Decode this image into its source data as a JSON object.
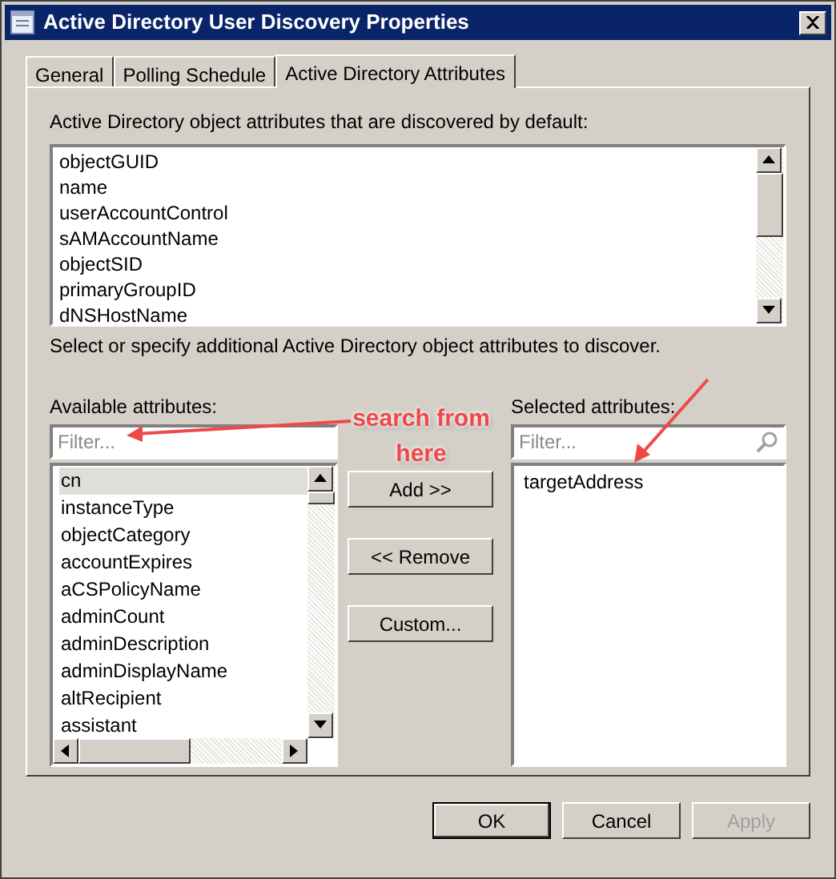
{
  "window": {
    "title": "Active Directory User Discovery Properties"
  },
  "tabs": [
    {
      "label": "General",
      "selected": false
    },
    {
      "label": "Polling Schedule",
      "selected": false
    },
    {
      "label": "Active Directory Attributes",
      "selected": true
    }
  ],
  "default_section": {
    "label": "Active Directory object attributes that are discovered by default:",
    "items": [
      "objectGUID",
      "name",
      "userAccountControl",
      "sAMAccountName",
      "objectSID",
      "primaryGroupID",
      "dNSHostName"
    ]
  },
  "hint": "Select or specify additional Active Directory object attributes to discover.",
  "available": {
    "label": "Available attributes:",
    "filter": {
      "placeholder": "Filter..."
    },
    "items": [
      {
        "text": "cn",
        "selected": true
      },
      {
        "text": "instanceType",
        "selected": false
      },
      {
        "text": "objectCategory",
        "selected": false
      },
      {
        "text": "accountExpires",
        "selected": false
      },
      {
        "text": "aCSPolicyName",
        "selected": false
      },
      {
        "text": "adminCount",
        "selected": false
      },
      {
        "text": "adminDescription",
        "selected": false
      },
      {
        "text": "adminDisplayName",
        "selected": false
      },
      {
        "text": "altRecipient",
        "selected": false
      },
      {
        "text": "assistant",
        "selected": false
      }
    ]
  },
  "middle_buttons": [
    "Add >>",
    "<< Remove",
    "Custom..."
  ],
  "selected": {
    "label": "Selected attributes:",
    "filter": {
      "placeholder": "Filter..."
    },
    "items": [
      {
        "text": "targetAddress",
        "selected": false
      }
    ]
  },
  "buttons": [
    {
      "label": "OK",
      "kind": "default",
      "disabled": false
    },
    {
      "label": "Cancel",
      "kind": "normal",
      "disabled": false
    },
    {
      "label": "Apply",
      "kind": "normal",
      "disabled": true
    }
  ],
  "annotation": {
    "text": "search from here"
  }
}
